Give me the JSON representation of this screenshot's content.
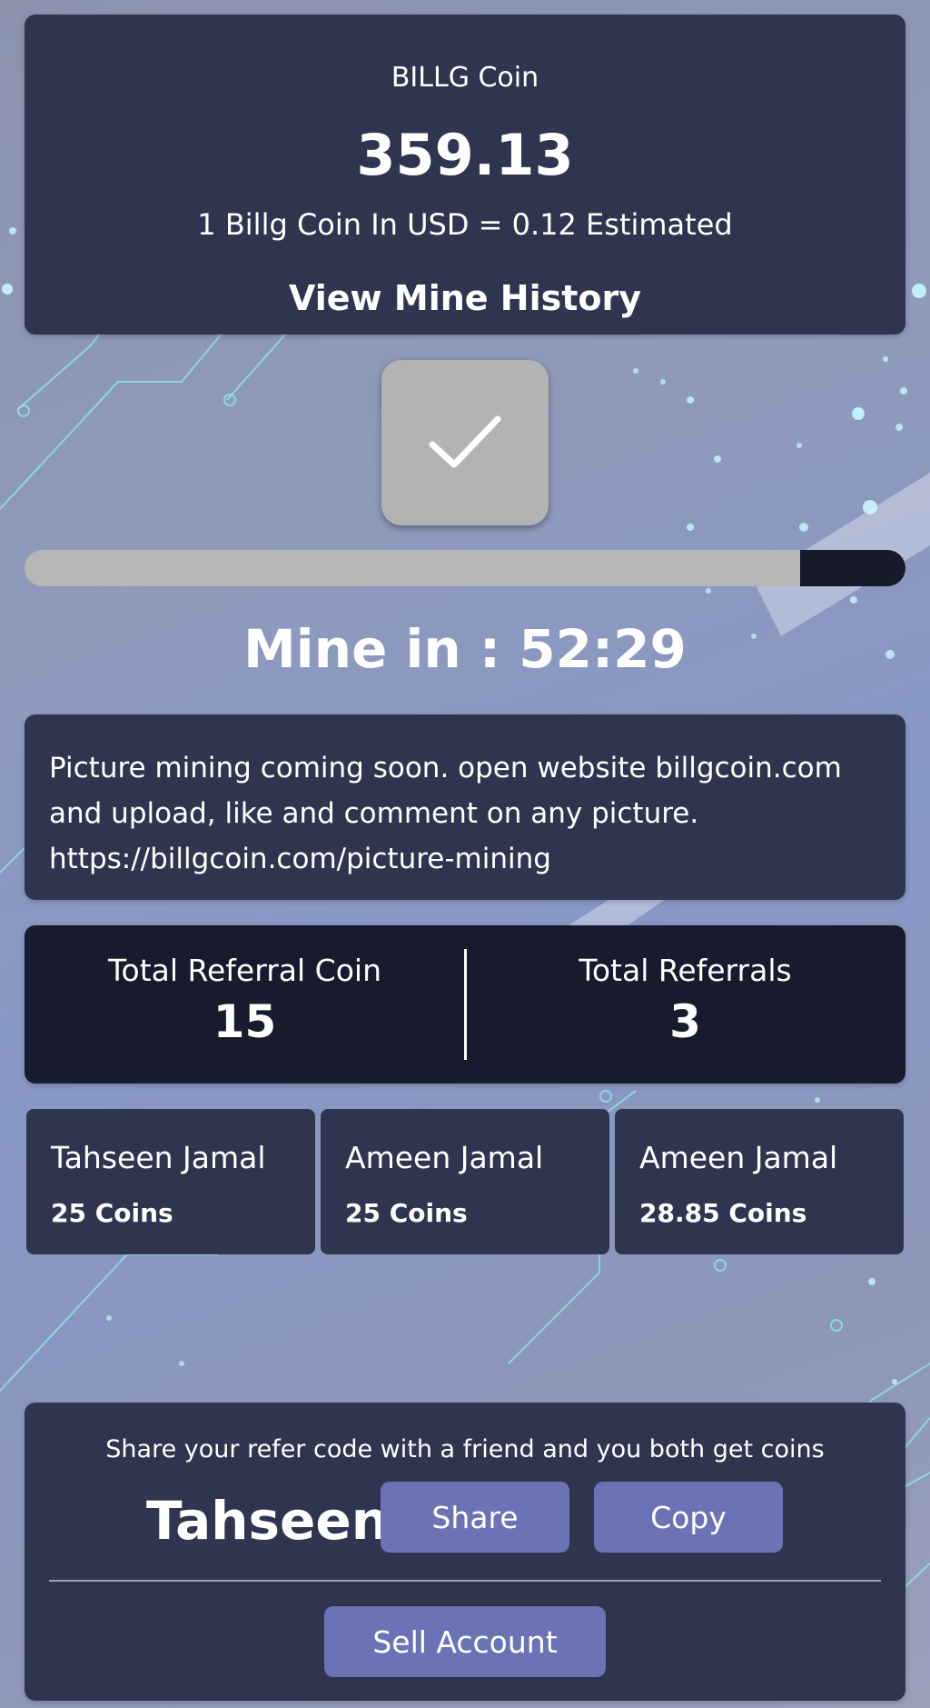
{
  "coin": {
    "name": "BILLG Coin",
    "balance": "359.13",
    "rate_text": "1 Billg Coin In USD = 0.12 Estimated",
    "history_link": "View Mine History"
  },
  "mining": {
    "button_icon": "checkmark-icon",
    "progress_fraction": 0.88,
    "countdown_text": "Mine in : 52:29"
  },
  "notice": {
    "text": "Picture mining coming soon. open website billgcoin.com and upload, like and comment on any picture. https://billgcoin.com/picture-mining"
  },
  "referral_stats": {
    "total_coin_label": "Total Referral Coin",
    "total_coin_value": "15",
    "total_referrals_label": "Total Referrals",
    "total_referrals_value": "3"
  },
  "referrals": [
    {
      "name": "Tahseen Jamal",
      "coins": "25 Coins"
    },
    {
      "name": "Ameen Jamal",
      "coins": "25 Coins"
    },
    {
      "name": "Ameen Jamal",
      "coins": "28.85 Coins"
    }
  ],
  "refer": {
    "hint": "Share your refer code with a friend and you both get coins",
    "code": "Tahseen",
    "share_label": "Share",
    "copy_label": "Copy",
    "sell_label": "Sell Account"
  },
  "colors": {
    "card": "#30354f",
    "card_dark": "#181a2d",
    "button": "#6b72b6",
    "mine_button": "#b3b3b3",
    "progress_track": "#b6b6b6"
  }
}
